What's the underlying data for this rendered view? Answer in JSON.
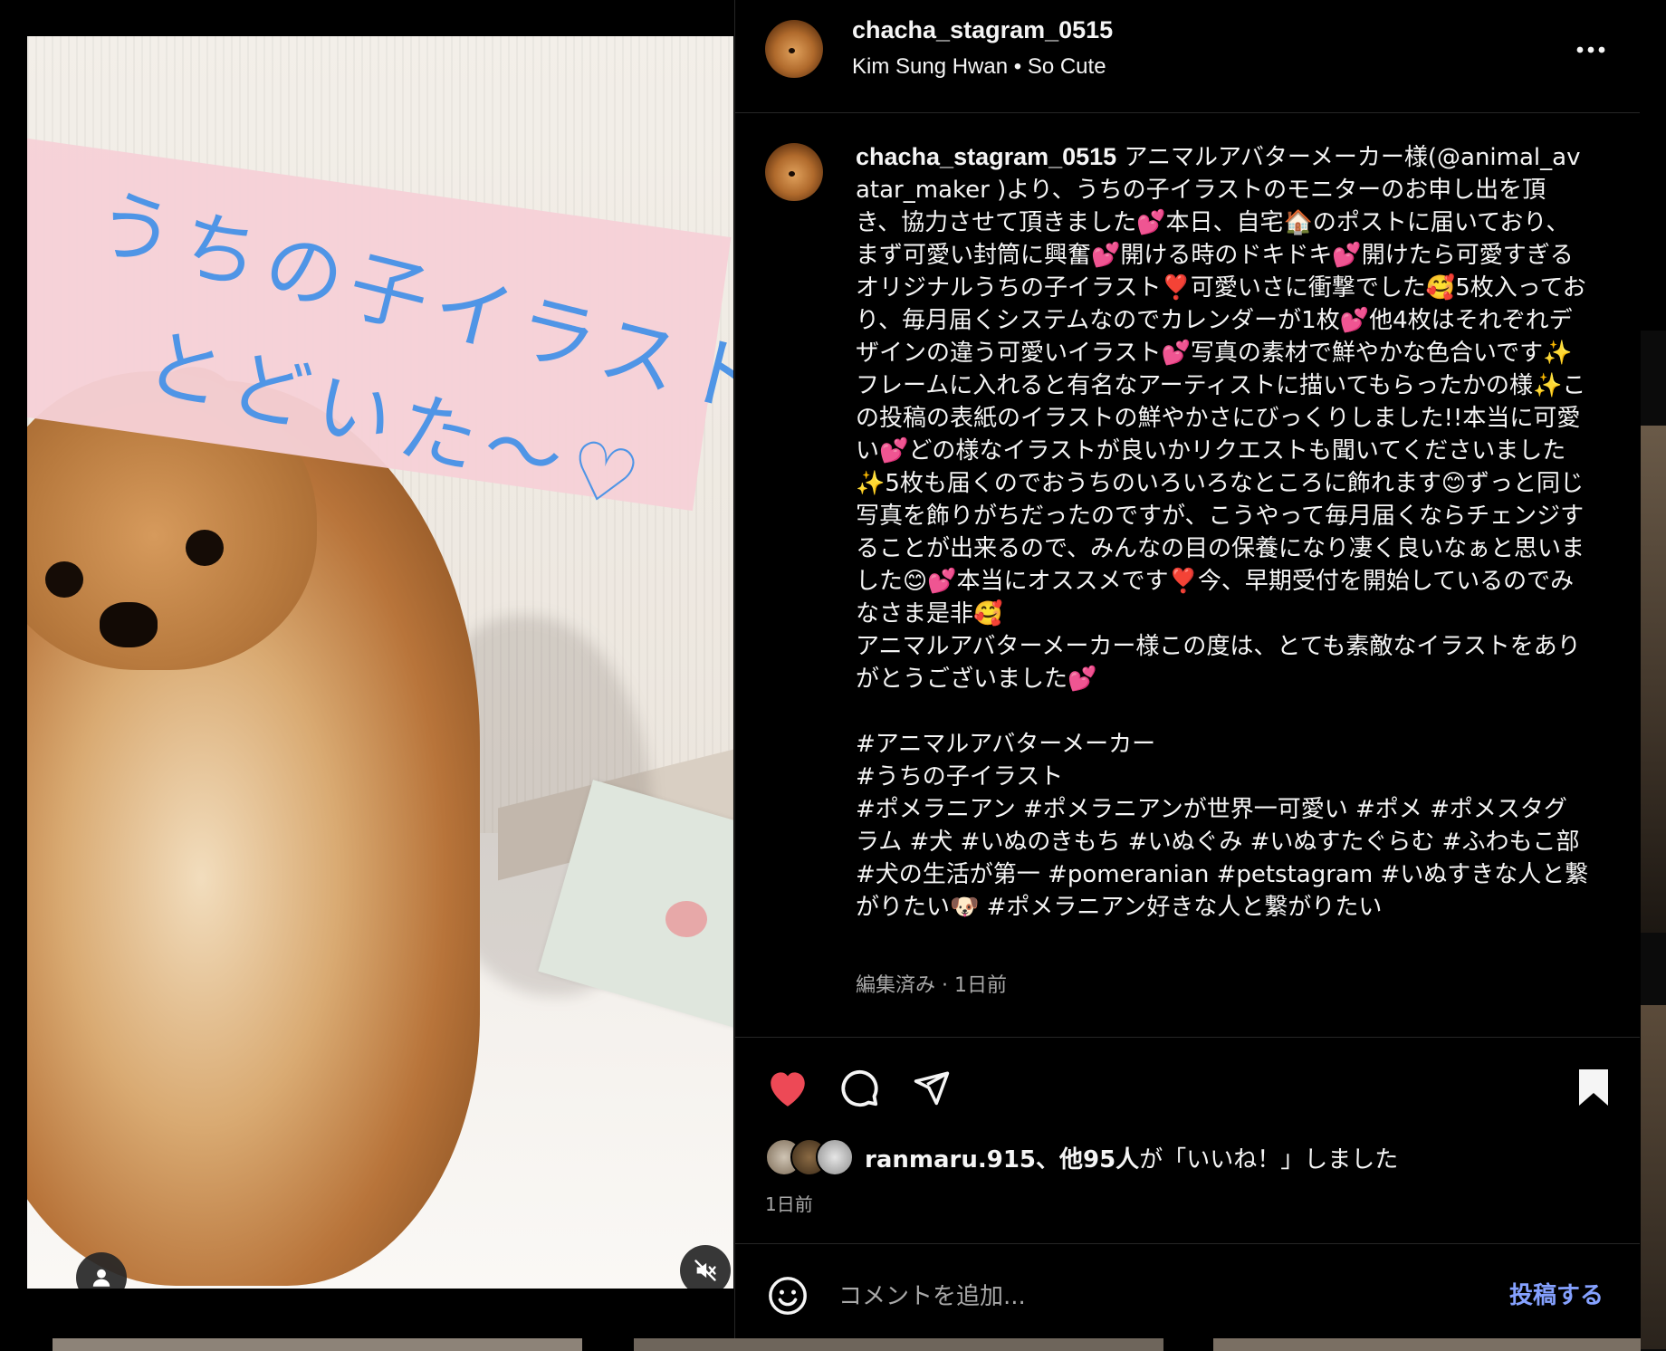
{
  "post": {
    "username": "chacha_stagram_0515",
    "subtitle": "Kim Sung Hwan • So Cute",
    "media_text": {
      "line1": "うちの子イラスト",
      "line2": "とどいた〜♡"
    },
    "caption": {
      "username": "chacha_stagram_0515",
      "first": " アニマルアバターメーカー様(@animal_avatar_maker )より、うちの子イラストのモニターのお申し出を頂き、協力させて頂きました💕本日、自宅🏠のポストに届いており、まず可愛い封筒に興奮💕開ける時のドキドキ💕開けたら可愛すぎるオリジナルうちの子イラスト❣️可愛いさに衝撃でした🥰5枚入っており、毎月届くシステムなのでカレンダーが1枚💕他4枚はそれぞれデザインの違う可愛いイラスト💕写真の素材で鮮やかな色合いです✨フレームに入れると有名なアーティストに描いてもらったかの様✨この投稿の表紙のイラストの鮮やかさにびっくりしました!!本当に可愛い💕どの様なイラストが良いかリクエストも聞いてくださいました✨5枚も届くのでおうちのいろいろなところに飾れます😊ずっと同じ写真を飾りがちだったのですが、こうやって毎月届くならチェンジすることが出来るので、みんなの目の保養になり凄く良いなぁと思いました😊💕本当にオススメです❣️今、早期受付を開始しているのでみなさま是非🥰",
      "second": "アニマルアバターメーカー様この度は、とても素敵なイラストをありがとうございました💕",
      "tags1": "#アニマルアバターメーカー",
      "tags2": "#うちの子イラスト",
      "tags3": "#ポメラニアン #ポメラニアンが世界一可愛い #ポメ #ポメスタグラム #犬 #いぬのきもち #いぬぐみ #いぬすたぐらむ #ふわもこ部 #犬の生活が第一 #pomeranian #petstagram #いぬすきな人と繋がりたい🐶 #ポメラニアン好きな人と繋がりたい"
    },
    "edited_label": "編集済み · 1日前",
    "liked_by_user": "ranmaru.915",
    "liked_by_rest": "、他95人",
    "liked_by_suffix": "が「いいね！」しました",
    "time_ago": "1日前",
    "comment_placeholder": "コメントを追加...",
    "post_button": "投稿する"
  },
  "colors": {
    "like": "#ed4956",
    "link": "#85a1ff",
    "secondary_text": "#a8a8a8",
    "handwriting": "#4f95e6",
    "pink_label": "#f6d1d7"
  },
  "icons": [
    "more-options-icon",
    "heart-icon",
    "comment-icon",
    "share-icon",
    "bookmark-icon",
    "emoji-icon",
    "user-tag-icon",
    "mute-icon"
  ]
}
